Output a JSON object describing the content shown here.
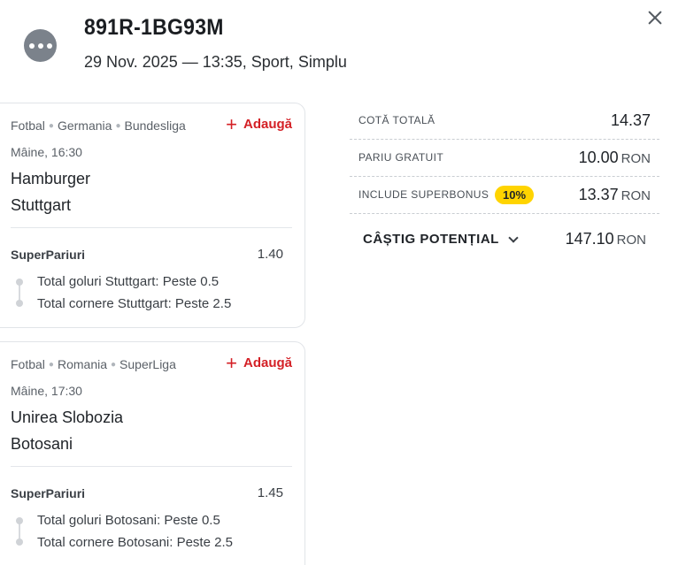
{
  "header": {
    "ticket_id": "891R-1BG93M",
    "meta": "29 Nov. 2025 — 13:35, Sport, Simplu",
    "menu_icon": "more-dots-icon",
    "close_icon": "close-icon"
  },
  "bets": [
    {
      "sport": "Fotbal",
      "country": "Germania",
      "league": "Bundesliga",
      "add_label": "Adaugă",
      "time": "Mâine, 16:30",
      "home": "Hamburger",
      "away": "Stuttgart",
      "market": "SuperPariuri",
      "odds": "1.40",
      "selections": [
        "Total goluri Stuttgart: Peste 0.5",
        "Total cornere Stuttgart: Peste 2.5"
      ]
    },
    {
      "sport": "Fotbal",
      "country": "Romania",
      "league": "SuperLiga",
      "add_label": "Adaugă",
      "time": "Mâine, 17:30",
      "home": "Unirea Slobozia",
      "away": "Botosani",
      "market": "SuperPariuri",
      "odds": "1.45",
      "selections": [
        "Total goluri Botosani: Peste 0.5",
        "Total cornere Botosani: Peste 2.5"
      ]
    }
  ],
  "summary": {
    "total_odds_label": "COTĂ TOTALĂ",
    "total_odds": "14.37",
    "free_bet_label": "PARIU GRATUIT",
    "free_bet": "10.00",
    "superbonus_label": "INCLUDE SUPERBONUS",
    "superbonus_badge": "10%",
    "superbonus_value": "13.37",
    "potential_win_label": "CÂȘTIG POTENȚIAL",
    "potential_win": "147.10",
    "currency": "RON"
  },
  "colors": {
    "accent_red": "#d42026",
    "badge_yellow": "#ffd400"
  }
}
